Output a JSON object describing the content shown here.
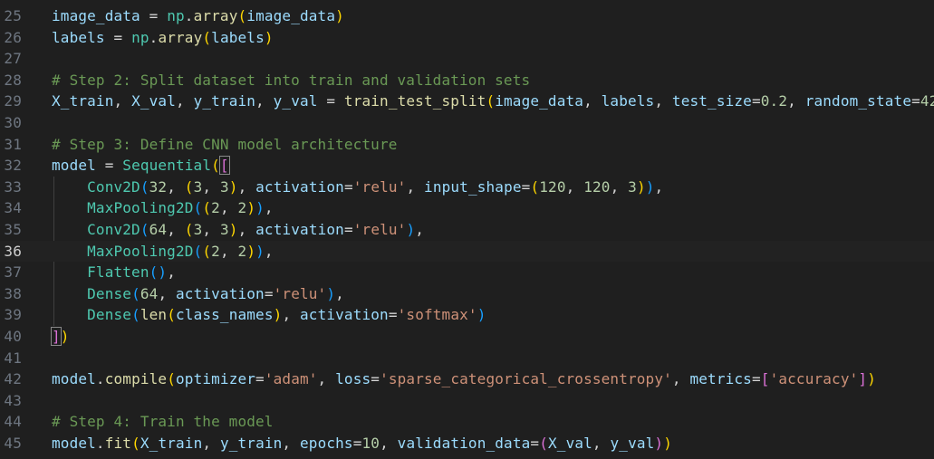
{
  "editor": {
    "current_line": "36",
    "lines": [
      {
        "no": "25",
        "tokens": [
          [
            "var",
            "image_data"
          ],
          [
            "op",
            " = "
          ],
          [
            "cls",
            "np"
          ],
          [
            "op",
            "."
          ],
          [
            "fn",
            "array"
          ],
          [
            "p1",
            "("
          ],
          [
            "var",
            "image_data"
          ],
          [
            "p1",
            ")"
          ]
        ]
      },
      {
        "no": "26",
        "tokens": [
          [
            "var",
            "labels"
          ],
          [
            "op",
            " = "
          ],
          [
            "cls",
            "np"
          ],
          [
            "op",
            "."
          ],
          [
            "fn",
            "array"
          ],
          [
            "p1",
            "("
          ],
          [
            "var",
            "labels"
          ],
          [
            "p1",
            ")"
          ]
        ]
      },
      {
        "no": "27",
        "tokens": []
      },
      {
        "no": "28",
        "tokens": [
          [
            "cmt",
            "# Step 2: Split dataset into train and validation sets"
          ]
        ]
      },
      {
        "no": "29",
        "tokens": [
          [
            "var",
            "X_train"
          ],
          [
            "op",
            ", "
          ],
          [
            "var",
            "X_val"
          ],
          [
            "op",
            ", "
          ],
          [
            "var",
            "y_train"
          ],
          [
            "op",
            ", "
          ],
          [
            "var",
            "y_val"
          ],
          [
            "op",
            " = "
          ],
          [
            "fn",
            "train_test_split"
          ],
          [
            "p1",
            "("
          ],
          [
            "var",
            "image_data"
          ],
          [
            "op",
            ", "
          ],
          [
            "var",
            "labels"
          ],
          [
            "op",
            ", "
          ],
          [
            "var",
            "test_size"
          ],
          [
            "op",
            "="
          ],
          [
            "num",
            "0.2"
          ],
          [
            "op",
            ", "
          ],
          [
            "var",
            "random_state"
          ],
          [
            "op",
            "="
          ],
          [
            "num",
            "42"
          ],
          [
            "p1",
            ")"
          ]
        ]
      },
      {
        "no": "30",
        "tokens": []
      },
      {
        "no": "31",
        "tokens": [
          [
            "cmt",
            "# Step 3: Define CNN model architecture"
          ]
        ]
      },
      {
        "no": "32",
        "tokens": [
          [
            "var",
            "model"
          ],
          [
            "op",
            " = "
          ],
          [
            "cls",
            "Sequential"
          ],
          [
            "p1",
            "("
          ],
          [
            "p2m",
            "["
          ]
        ]
      },
      {
        "no": "33",
        "tokens": [
          [
            "op",
            "    "
          ],
          [
            "cls",
            "Conv2D"
          ],
          [
            "p3",
            "("
          ],
          [
            "num",
            "32"
          ],
          [
            "op",
            ", "
          ],
          [
            "p1",
            "("
          ],
          [
            "num",
            "3"
          ],
          [
            "op",
            ", "
          ],
          [
            "num",
            "3"
          ],
          [
            "p1",
            ")"
          ],
          [
            "op",
            ", "
          ],
          [
            "var",
            "activation"
          ],
          [
            "op",
            "="
          ],
          [
            "str",
            "'relu'"
          ],
          [
            "op",
            ", "
          ],
          [
            "var",
            "input_shape"
          ],
          [
            "op",
            "="
          ],
          [
            "p1",
            "("
          ],
          [
            "num",
            "120"
          ],
          [
            "op",
            ", "
          ],
          [
            "num",
            "120"
          ],
          [
            "op",
            ", "
          ],
          [
            "num",
            "3"
          ],
          [
            "p1",
            ")"
          ],
          [
            "p3",
            ")"
          ],
          [
            "op",
            ","
          ]
        ]
      },
      {
        "no": "34",
        "tokens": [
          [
            "op",
            "    "
          ],
          [
            "cls",
            "MaxPooling2D"
          ],
          [
            "p3",
            "("
          ],
          [
            "p1",
            "("
          ],
          [
            "num",
            "2"
          ],
          [
            "op",
            ", "
          ],
          [
            "num",
            "2"
          ],
          [
            "p1",
            ")"
          ],
          [
            "p3",
            ")"
          ],
          [
            "op",
            ","
          ]
        ]
      },
      {
        "no": "35",
        "tokens": [
          [
            "op",
            "    "
          ],
          [
            "cls",
            "Conv2D"
          ],
          [
            "p3",
            "("
          ],
          [
            "num",
            "64"
          ],
          [
            "op",
            ", "
          ],
          [
            "p1",
            "("
          ],
          [
            "num",
            "3"
          ],
          [
            "op",
            ", "
          ],
          [
            "num",
            "3"
          ],
          [
            "p1",
            ")"
          ],
          [
            "op",
            ", "
          ],
          [
            "var",
            "activation"
          ],
          [
            "op",
            "="
          ],
          [
            "str",
            "'relu'"
          ],
          [
            "p3",
            ")"
          ],
          [
            "op",
            ","
          ]
        ]
      },
      {
        "no": "36",
        "tokens": [
          [
            "op",
            "    "
          ],
          [
            "cls",
            "MaxPooling2D"
          ],
          [
            "p3",
            "("
          ],
          [
            "p1",
            "("
          ],
          [
            "num",
            "2"
          ],
          [
            "op",
            ", "
          ],
          [
            "num",
            "2"
          ],
          [
            "p1",
            ")"
          ],
          [
            "p3",
            ")"
          ],
          [
            "op",
            ","
          ]
        ]
      },
      {
        "no": "37",
        "tokens": [
          [
            "op",
            "    "
          ],
          [
            "cls",
            "Flatten"
          ],
          [
            "p3",
            "()"
          ],
          [
            "op",
            ","
          ]
        ]
      },
      {
        "no": "38",
        "tokens": [
          [
            "op",
            "    "
          ],
          [
            "cls",
            "Dense"
          ],
          [
            "p3",
            "("
          ],
          [
            "num",
            "64"
          ],
          [
            "op",
            ", "
          ],
          [
            "var",
            "activation"
          ],
          [
            "op",
            "="
          ],
          [
            "str",
            "'relu'"
          ],
          [
            "p3",
            ")"
          ],
          [
            "op",
            ","
          ]
        ]
      },
      {
        "no": "39",
        "tokens": [
          [
            "op",
            "    "
          ],
          [
            "cls",
            "Dense"
          ],
          [
            "p3",
            "("
          ],
          [
            "bi",
            "len"
          ],
          [
            "p1",
            "("
          ],
          [
            "var",
            "class_names"
          ],
          [
            "p1",
            ")"
          ],
          [
            "op",
            ", "
          ],
          [
            "var",
            "activation"
          ],
          [
            "op",
            "="
          ],
          [
            "str",
            "'softmax'"
          ],
          [
            "p3",
            ")"
          ]
        ]
      },
      {
        "no": "40",
        "tokens": [
          [
            "p2m",
            "]"
          ],
          [
            "p1",
            ")"
          ]
        ]
      },
      {
        "no": "41",
        "tokens": []
      },
      {
        "no": "42",
        "tokens": [
          [
            "var",
            "model"
          ],
          [
            "op",
            "."
          ],
          [
            "fn",
            "compile"
          ],
          [
            "p1",
            "("
          ],
          [
            "var",
            "optimizer"
          ],
          [
            "op",
            "="
          ],
          [
            "str",
            "'adam'"
          ],
          [
            "op",
            ", "
          ],
          [
            "var",
            "loss"
          ],
          [
            "op",
            "="
          ],
          [
            "str",
            "'sparse_categorical_crossentropy'"
          ],
          [
            "op",
            ", "
          ],
          [
            "var",
            "metrics"
          ],
          [
            "op",
            "="
          ],
          [
            "p2",
            "["
          ],
          [
            "str",
            "'accuracy'"
          ],
          [
            "p2",
            "]"
          ],
          [
            "p1",
            ")"
          ]
        ]
      },
      {
        "no": "43",
        "tokens": []
      },
      {
        "no": "44",
        "tokens": [
          [
            "cmt",
            "# Step 4: Train the model"
          ]
        ]
      },
      {
        "no": "45",
        "tokens": [
          [
            "var",
            "model"
          ],
          [
            "op",
            "."
          ],
          [
            "fn",
            "fit"
          ],
          [
            "p1",
            "("
          ],
          [
            "var",
            "X_train"
          ],
          [
            "op",
            ", "
          ],
          [
            "var",
            "y_train"
          ],
          [
            "op",
            ", "
          ],
          [
            "var",
            "epochs"
          ],
          [
            "op",
            "="
          ],
          [
            "num",
            "10"
          ],
          [
            "op",
            ", "
          ],
          [
            "var",
            "validation_data"
          ],
          [
            "op",
            "="
          ],
          [
            "p2",
            "("
          ],
          [
            "var",
            "X_val"
          ],
          [
            "op",
            ", "
          ],
          [
            "var",
            "y_val"
          ],
          [
            "p2",
            ")"
          ],
          [
            "p1",
            ")"
          ]
        ]
      }
    ]
  }
}
